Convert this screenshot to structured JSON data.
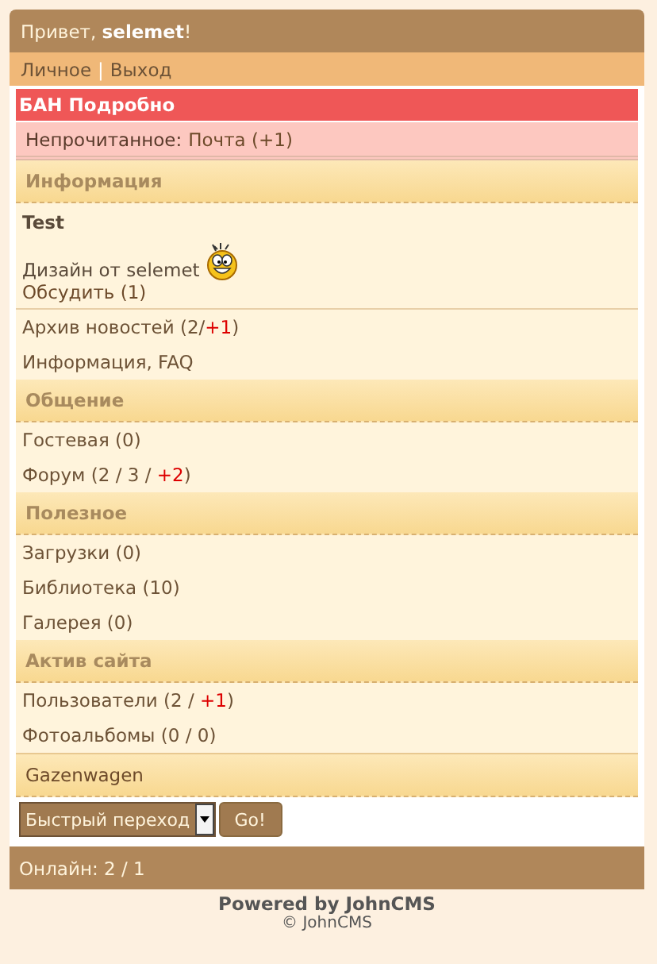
{
  "header": {
    "greeting": "Привет, **selemet**!"
  },
  "nav": {
    "links": [
      "Личное",
      "Выход"
    ],
    "separator": "|"
  },
  "alert": {
    "title": "БАН Подробно"
  },
  "unread": {
    "label": "Непрочитанное:",
    "link": "Почта (+1)"
  },
  "sections": [
    {
      "kind": "group",
      "title": "Информация",
      "news": {
        "title": "Test",
        "text": "Дизайн от selemet",
        "discuss": "Обсудить (1)"
      },
      "items": [
        {
          "parts": [
            {
              "text": "Архив новостей (2/",
              "new": false
            },
            {
              "text": "+1",
              "new": true
            },
            {
              "text": ")",
              "new": false
            }
          ]
        },
        {
          "parts": [
            {
              "text": "Информация, FAQ",
              "new": false
            }
          ]
        }
      ]
    },
    {
      "kind": "group",
      "title": "Общение",
      "items": [
        {
          "parts": [
            {
              "text": "Гостевая (0)",
              "new": false
            }
          ]
        },
        {
          "parts": [
            {
              "text": "Форум (2 / 3 / ",
              "new": false
            },
            {
              "text": "+2",
              "new": true
            },
            {
              "text": ")",
              "new": false
            }
          ]
        }
      ]
    },
    {
      "kind": "group",
      "title": "Полезное",
      "items": [
        {
          "parts": [
            {
              "text": "Загрузки (0)",
              "new": false
            }
          ]
        },
        {
          "parts": [
            {
              "text": "Библиотека (10)",
              "new": false
            }
          ]
        },
        {
          "parts": [
            {
              "text": "Галерея (0)",
              "new": false
            }
          ]
        }
      ]
    },
    {
      "kind": "group",
      "title": "Актив сайта",
      "items": [
        {
          "parts": [
            {
              "text": "Пользователи (2 / ",
              "new": false
            },
            {
              "text": "+1",
              "new": true
            },
            {
              "text": ")",
              "new": false
            }
          ]
        },
        {
          "parts": [
            {
              "text": "Фотоальбомы (0 / 0)",
              "new": false
            }
          ]
        }
      ]
    },
    {
      "kind": "banner",
      "title": "Gazenwagen"
    }
  ],
  "quick": {
    "select": "Быстрый переход",
    "button": "Go!"
  },
  "footer": {
    "online": "Онлайн: 2 / 1",
    "powered": "Powered by JohnCMS",
    "copyright": "© JohnCMS"
  }
}
